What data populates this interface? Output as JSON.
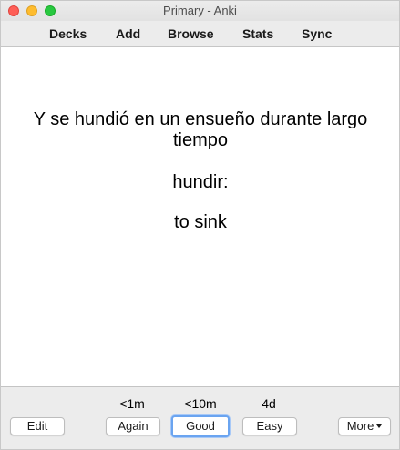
{
  "window": {
    "title": "Primary - Anki"
  },
  "toolbar": {
    "items": [
      {
        "label": "Decks"
      },
      {
        "label": "Add"
      },
      {
        "label": "Browse"
      },
      {
        "label": "Stats"
      },
      {
        "label": "Sync"
      }
    ]
  },
  "card": {
    "question": "Y se hundió en un ensueño durante largo tiempo",
    "answer_word": "hundir:",
    "answer_meaning": "to sink"
  },
  "bottom": {
    "edit_label": "Edit",
    "more_label": "More",
    "answers": [
      {
        "interval": "<1m",
        "label": "Again"
      },
      {
        "interval": "<10m",
        "label": "Good"
      },
      {
        "interval": "4d",
        "label": "Easy"
      }
    ]
  }
}
